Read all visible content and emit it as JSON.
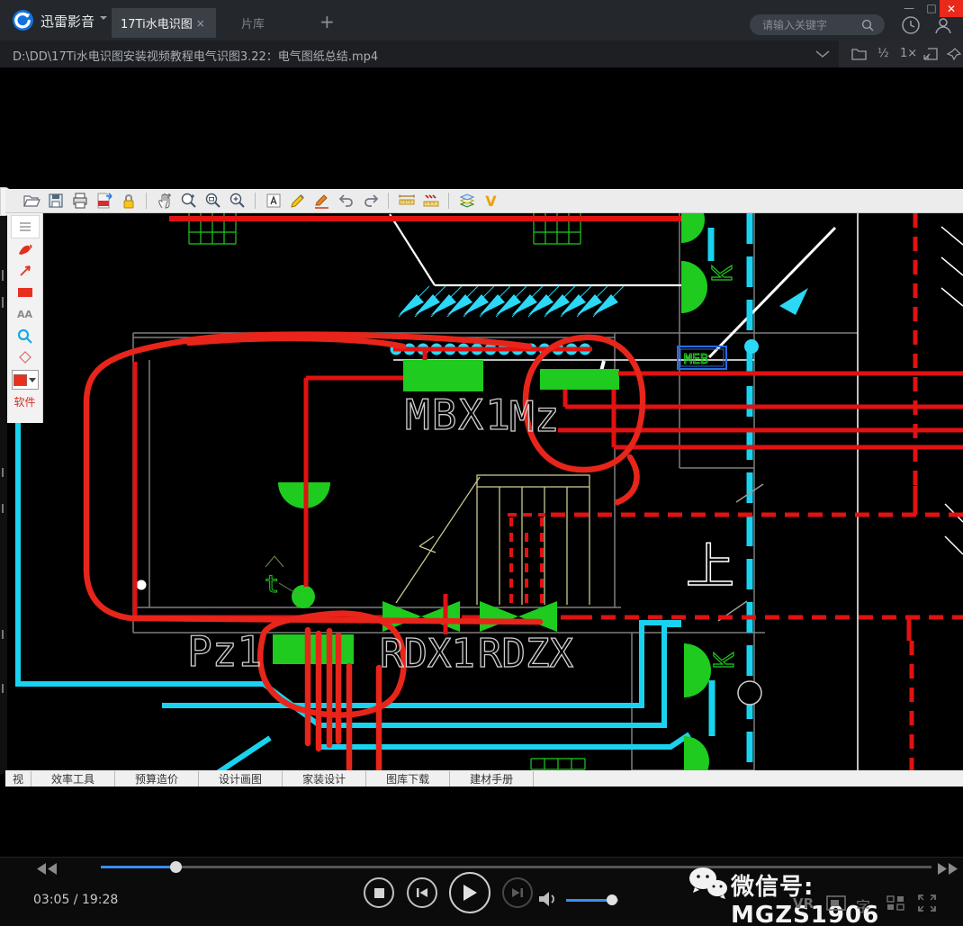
{
  "window": {
    "app_name": "迅雷影音",
    "tabs": [
      {
        "label": "17Ti水电识图"
      },
      {
        "label": "片库"
      }
    ],
    "tab_close": "×",
    "new_tab": "+",
    "search_placeholder": "请输入关键字",
    "controls": {
      "minimize": "—",
      "maximize": "□",
      "close": "✕"
    }
  },
  "path_bar": {
    "file_path": "D:\\DD\\17Ti水电识图安装视频教程电气识图3.22：电气图纸总结.mp4",
    "speed_half": "½",
    "speed_normal": "1×"
  },
  "cad": {
    "toolbar_icons": [
      "open",
      "save",
      "print",
      "export-pdf",
      "lock",
      "pan",
      "zoom",
      "zoom-window",
      "zoom-extents",
      "text-annotate",
      "pencil",
      "brush",
      "undo",
      "redo",
      "measure",
      "measure-continuous",
      "layers",
      "v-logo"
    ],
    "v_logo": "V",
    "sidebar_text_tool": "AA",
    "sidebar_watermark": "软件",
    "bottom_menu": [
      "视",
      "效率工具",
      "预算造价",
      "设计画图",
      "家装设计",
      "图库下载",
      "建材手册"
    ],
    "labels": {
      "mbx1": "MBX1",
      "mz": "Mz",
      "pz1": "Pz1",
      "rdx1": "RDX1",
      "rdzx": "RDZX",
      "k_upper": "K",
      "k_lower": "K",
      "up": "上",
      "t": "t",
      "meb": "MEB"
    }
  },
  "player": {
    "time_display": "03:05 / 19:28",
    "progress_percent": 15.8,
    "volume_percent": 90,
    "watermark_text": "微信号: MGZS1906",
    "vr_label": "VR",
    "subtitle_label": "字"
  },
  "colors": {
    "accent_blue": "#3b8df0",
    "close_red": "#e8291c",
    "cad_green": "#1ecb1e",
    "cad_cyan": "#19d2ef",
    "cad_red": "#e01212",
    "annotation_red": "#e8251a",
    "stair_yellow": "#c9c98f"
  }
}
